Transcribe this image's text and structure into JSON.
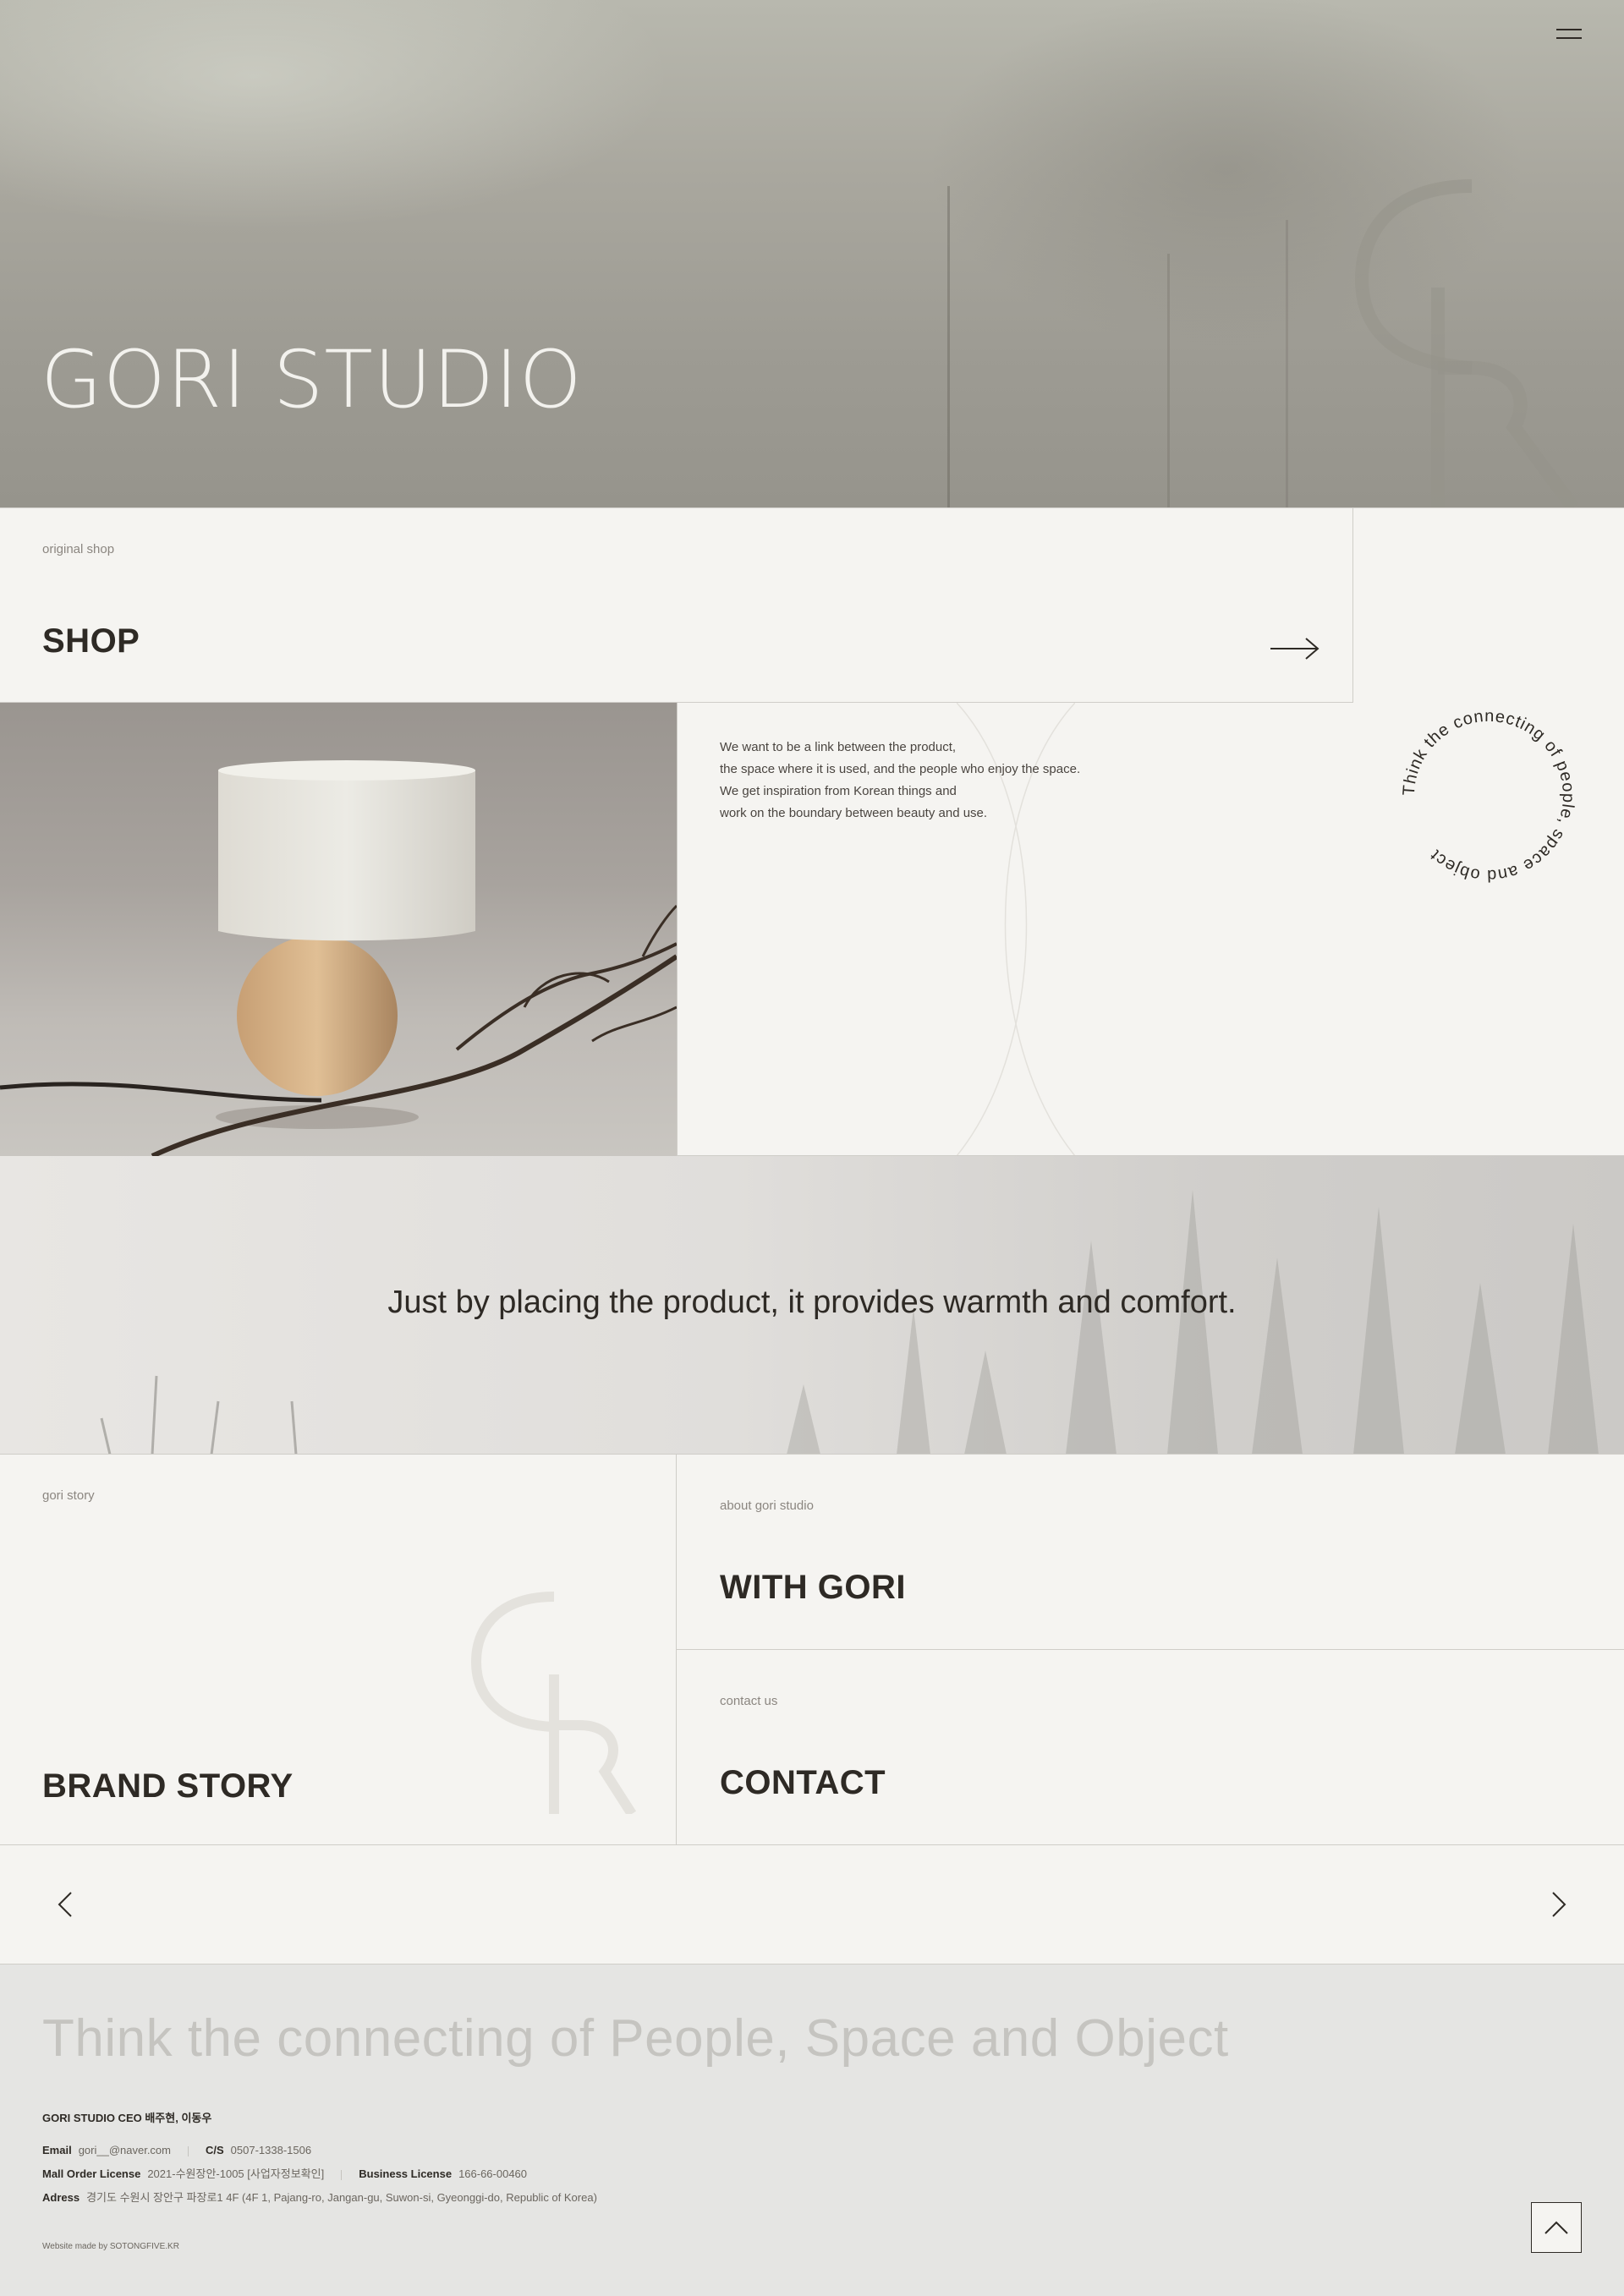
{
  "hero": {
    "title": "GORI STUDIO",
    "menu_icon": "hamburger-menu-icon"
  },
  "shop": {
    "eyebrow": "original shop",
    "title": "SHOP",
    "arrow_icon": "arrow-right-icon"
  },
  "circle_text": "Think the connecting of people, space and object",
  "description": {
    "lines": [
      "We want to be a link between the product,",
      "the space where it is used, and the people who enjoy the space.",
      "We get inspiration from Korean things and",
      "work on the boundary between beauty and use."
    ]
  },
  "tagline": "Just by placing the product, it provides warmth and comfort.",
  "story": {
    "eyebrow": "gori story",
    "title": "BRAND STORY"
  },
  "with_gori": {
    "eyebrow": "about gori studio",
    "title": "WITH GORI"
  },
  "contact": {
    "eyebrow": "contact us",
    "title": "CONTACT"
  },
  "pager": {
    "prev_icon": "chevron-left-icon",
    "next_icon": "chevron-right-icon"
  },
  "footer": {
    "slogan": "Think the connecting of People, Space and Object",
    "ceo": "GORI STUDIO CEO 배주현, 이동우",
    "email_label": "Email",
    "email_value": "gori__@naver.com",
    "cs_label": "C/S",
    "cs_value": "0507-1338-1506",
    "mall_label": "Mall Order License",
    "mall_value": "2021-수원장안-1005 [사업자정보확인]",
    "biz_label": "Business License",
    "biz_value": "166-66-00460",
    "address_label": "Adress",
    "address_value": "경기도 수원시 장안구 파장로1 4F (4F 1, Pajang-ro, Jangan-gu, Suwon-si, Gyeonggi-do, Republic of Korea)",
    "credit_prefix": "Website made by",
    "credit_name": "SOTONGFIVE.KR",
    "top_icon": "chevron-up-icon"
  },
  "colors": {
    "text": "#2e2a25",
    "background": "#f5f4f1",
    "footer_bg": "#e5e5e3",
    "border": "#cfcdc8"
  }
}
